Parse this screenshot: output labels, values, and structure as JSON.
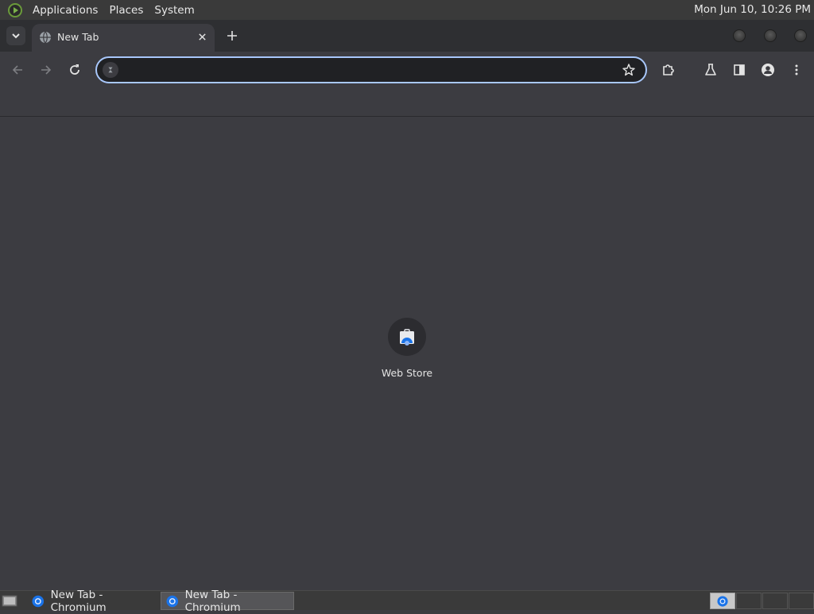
{
  "top_panel": {
    "menus": [
      "Applications",
      "Places",
      "System"
    ],
    "clock": "Mon Jun 10, 10:26 PM"
  },
  "browser": {
    "tab": {
      "title": "New Tab",
      "favicon": "chromium-globe-icon"
    },
    "omnibox": {
      "value": "",
      "placeholder": ""
    },
    "shortcuts": [
      {
        "label": "Web Store",
        "icon": "web-store-icon"
      }
    ],
    "colors": {
      "accent": "#a8c7fa",
      "background": "#3c3c41",
      "frame": "#2e2f32"
    }
  },
  "taskbar": {
    "tasks": [
      {
        "label": "New Tab - Chromium",
        "active": false
      },
      {
        "label": "New Tab - Chromium",
        "active": true
      }
    ]
  }
}
